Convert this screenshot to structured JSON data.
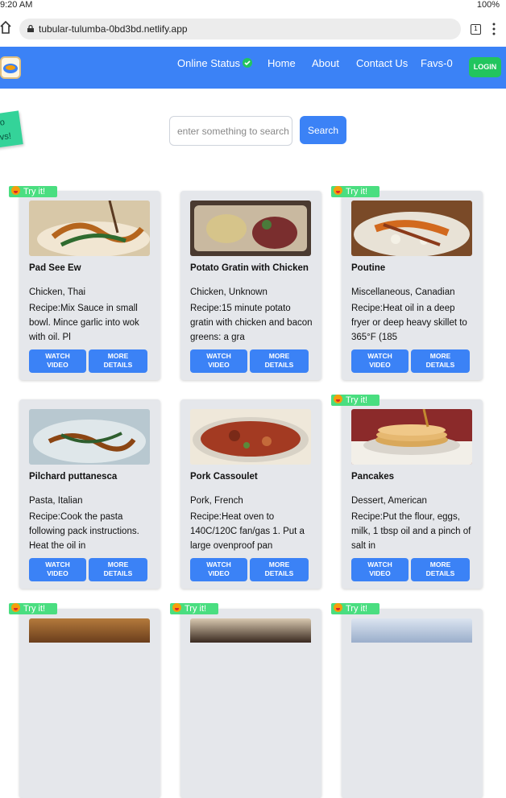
{
  "status_bar": {
    "time": "9:20 AM",
    "battery": "100%"
  },
  "browser": {
    "url": "tubular-tulumba-0bd3bd.netlify.app",
    "tab_count": "1"
  },
  "nav": {
    "online_status": "Online Status",
    "home": "Home",
    "about": "About",
    "contact": "Contact Us",
    "favs": "Favs-0",
    "login": "LOGIN"
  },
  "sticky_note": {
    "line1": "ello",
    "line2": "levs!"
  },
  "search": {
    "placeholder": "enter something to search",
    "button": "Search"
  },
  "badge_label": "Try it!",
  "buttons": {
    "watch_line1": "WATCH",
    "watch_line2": "VIDEO",
    "more_line1": "MORE",
    "more_line2": "DETAILS"
  },
  "recipes": [
    {
      "name": "Pad See Ew",
      "tags": "Chicken, Thai",
      "recipe": "Recipe:Mix Sauce in small bowl. Mince garlic into wok with oil. Pl",
      "try_it": true
    },
    {
      "name": "Potato Gratin with Chicken",
      "tags": "Chicken, Unknown",
      "recipe": "Recipe:15 minute potato gratin with chicken and bacon greens: a gra",
      "try_it": false
    },
    {
      "name": "Poutine",
      "tags": "Miscellaneous, Canadian",
      "recipe": "Recipe:Heat oil in a deep fryer or deep heavy skillet to 365°F (185",
      "try_it": true
    },
    {
      "name": "Pilchard puttanesca",
      "tags": "Pasta, Italian",
      "recipe": "Recipe:Cook the pasta following pack instructions. Heat the oil in",
      "try_it": false
    },
    {
      "name": "Pork Cassoulet",
      "tags": "Pork, French",
      "recipe": "Recipe:Heat oven to 140C/120C fan/gas 1. Put a large ovenproof pan",
      "try_it": false
    },
    {
      "name": "Pancakes",
      "tags": "Dessert, American",
      "recipe": "Recipe:Put the flour, eggs, milk, 1 tbsp oil and a pinch of salt in",
      "try_it": true
    }
  ]
}
